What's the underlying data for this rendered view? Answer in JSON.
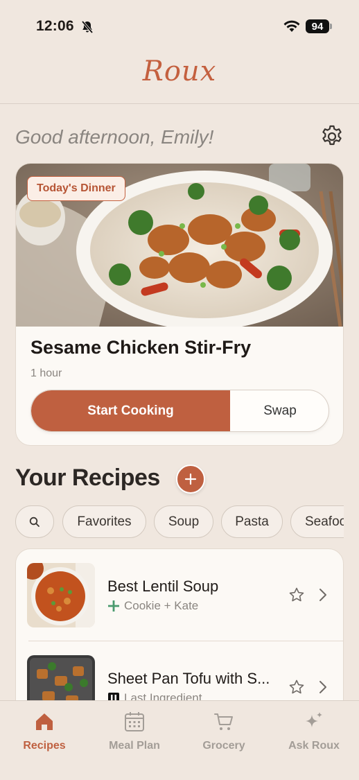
{
  "status_bar": {
    "time": "12:06",
    "battery": "94"
  },
  "app": {
    "logo": "Roux"
  },
  "greeting": "Good afternoon, Emily!",
  "dinner": {
    "badge": "Today's Dinner",
    "title": "Sesame Chicken Stir-Fry",
    "time": "1 hour",
    "start_label": "Start Cooking",
    "swap_label": "Swap"
  },
  "recipes": {
    "heading": "Your Recipes",
    "filters": [
      "Favorites",
      "Soup",
      "Pasta",
      "Seafood"
    ],
    "items": [
      {
        "title": "Best Lentil Soup",
        "subtitle": "Cookie + Kate",
        "source_icon": "plus-icon"
      },
      {
        "title": "Sheet Pan Tofu with S...",
        "subtitle": "Last Ingredient",
        "source_icon": "book-icon"
      }
    ]
  },
  "tabs": [
    {
      "label": "Recipes",
      "icon": "home-icon",
      "active": true
    },
    {
      "label": "Meal Plan",
      "icon": "calendar-icon",
      "active": false
    },
    {
      "label": "Grocery",
      "icon": "cart-icon",
      "active": false
    },
    {
      "label": "Ask Roux",
      "icon": "sparkle-icon",
      "active": false
    }
  ],
  "colors": {
    "accent": "#bf6040",
    "background": "#f0e7df",
    "card": "#fcf9f5",
    "muted": "#8a8580",
    "green": "#4a9a6e"
  }
}
